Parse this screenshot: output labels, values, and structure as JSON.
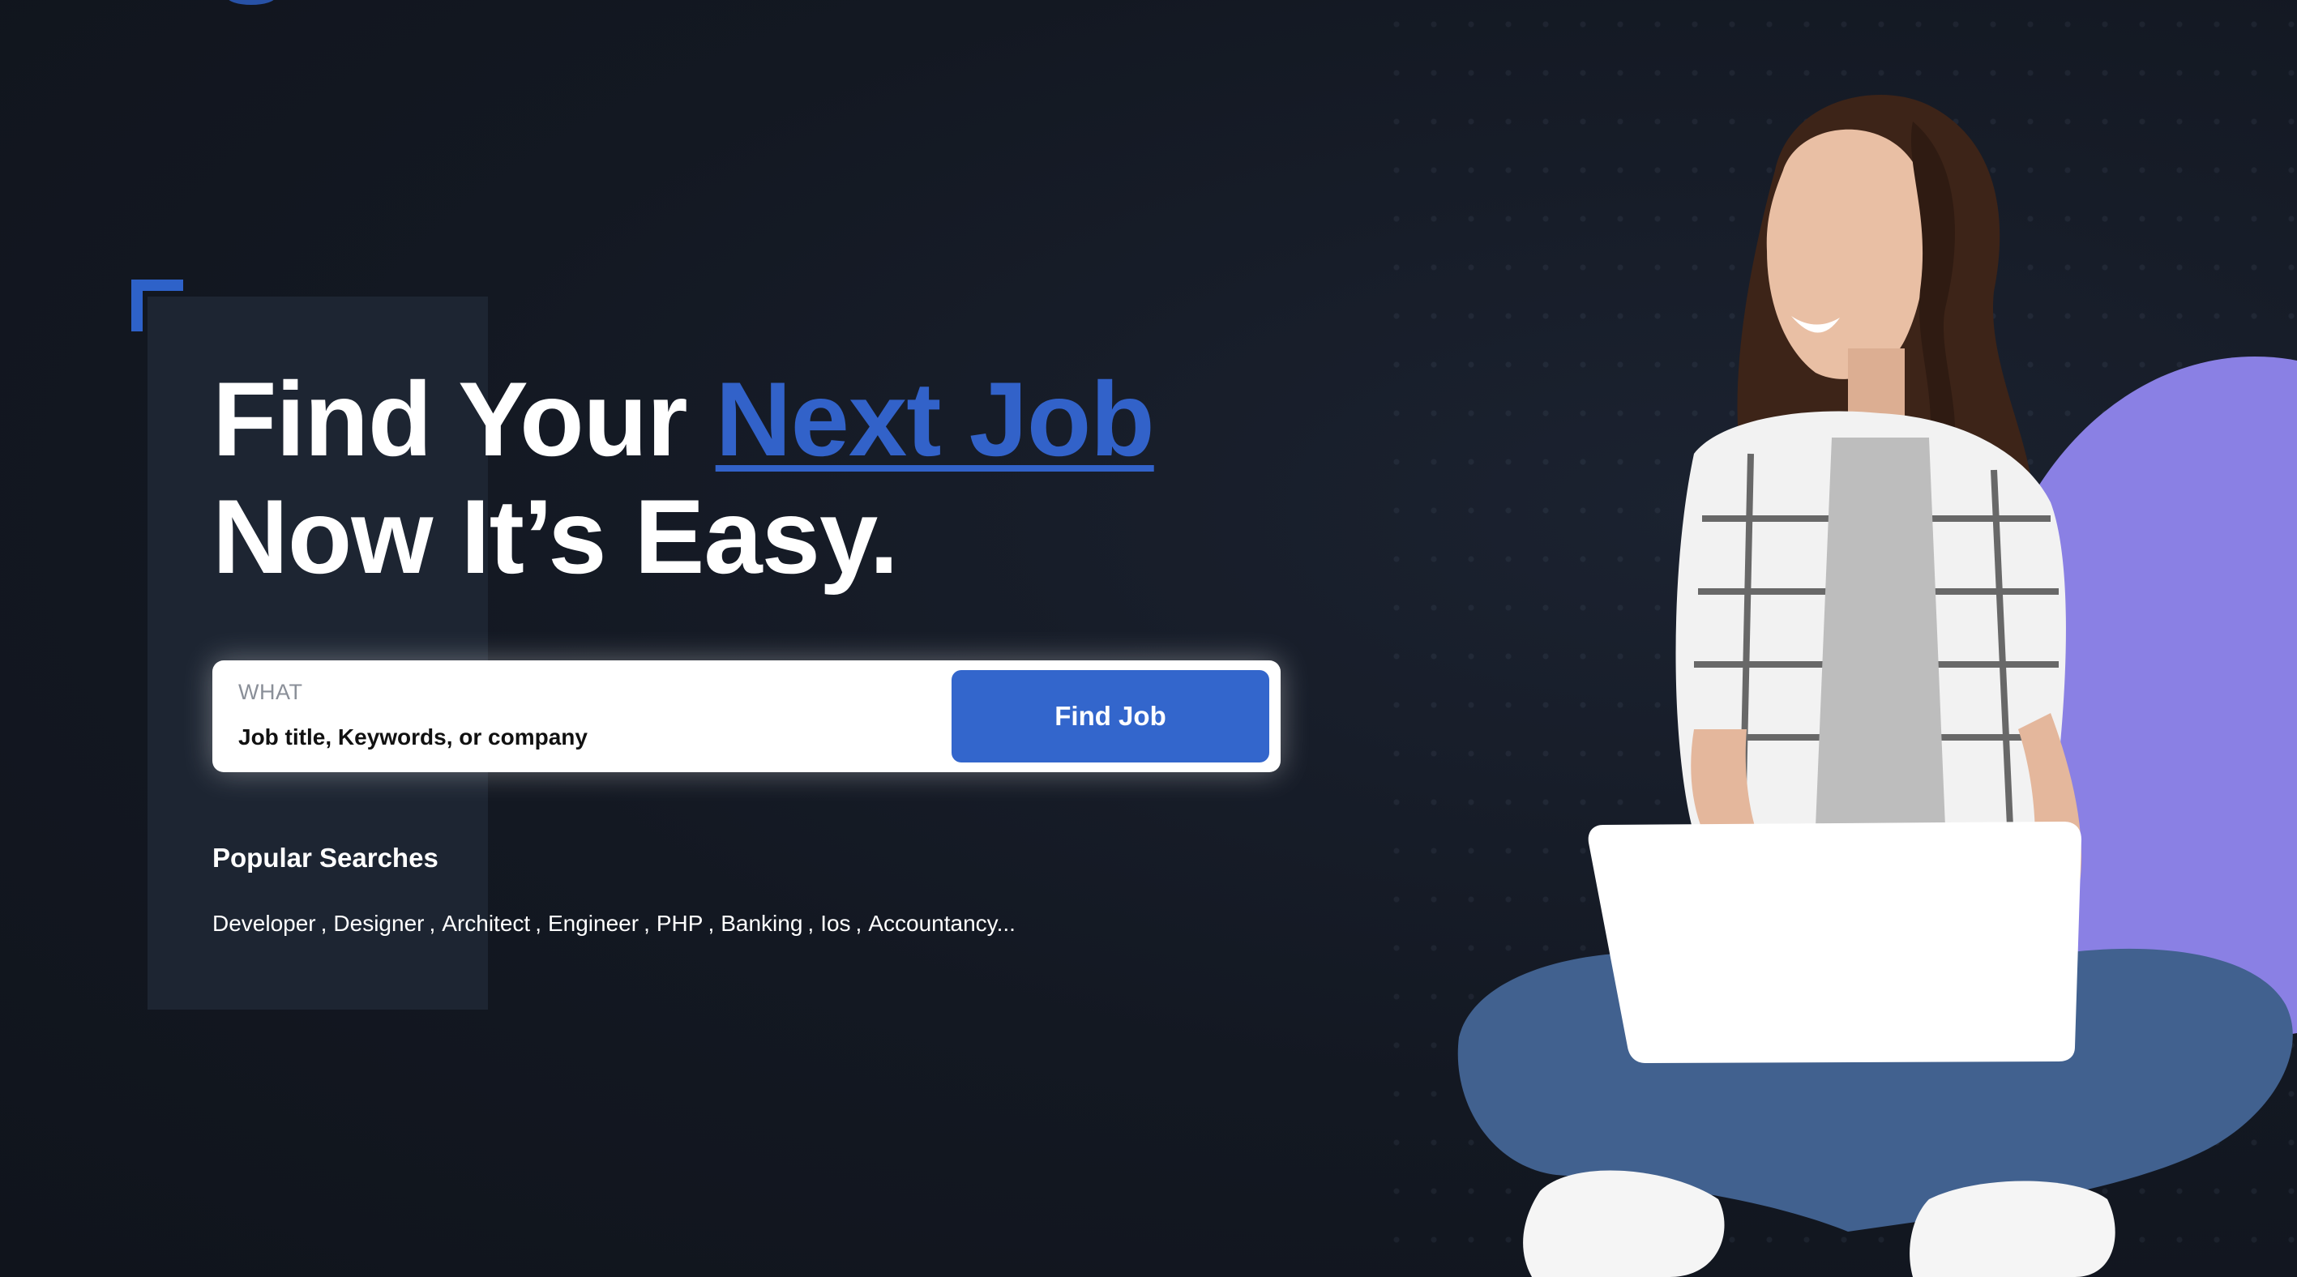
{
  "hero": {
    "headline_part1": "Find Your ",
    "headline_highlight": "Next Job",
    "headline_line2": "Now It’s Easy."
  },
  "search": {
    "label": "WHAT",
    "placeholder": "Job title, Keywords, or company",
    "value": "",
    "button_label": "Find Job"
  },
  "popular": {
    "title": "Popular Searches",
    "items": [
      "Developer",
      "Designer",
      "Architect",
      "Engineer",
      "PHP",
      "Banking",
      "Ios",
      "Accountancy..."
    ],
    "separator": ","
  },
  "colors": {
    "background": "#131822",
    "accent_blue": "#3366cc",
    "highlight_blue": "#3262c9",
    "panel": "#1d2532",
    "circle_purple": "#8a80e4"
  },
  "icons": {
    "hero_image": "woman-with-laptop-illustration"
  }
}
